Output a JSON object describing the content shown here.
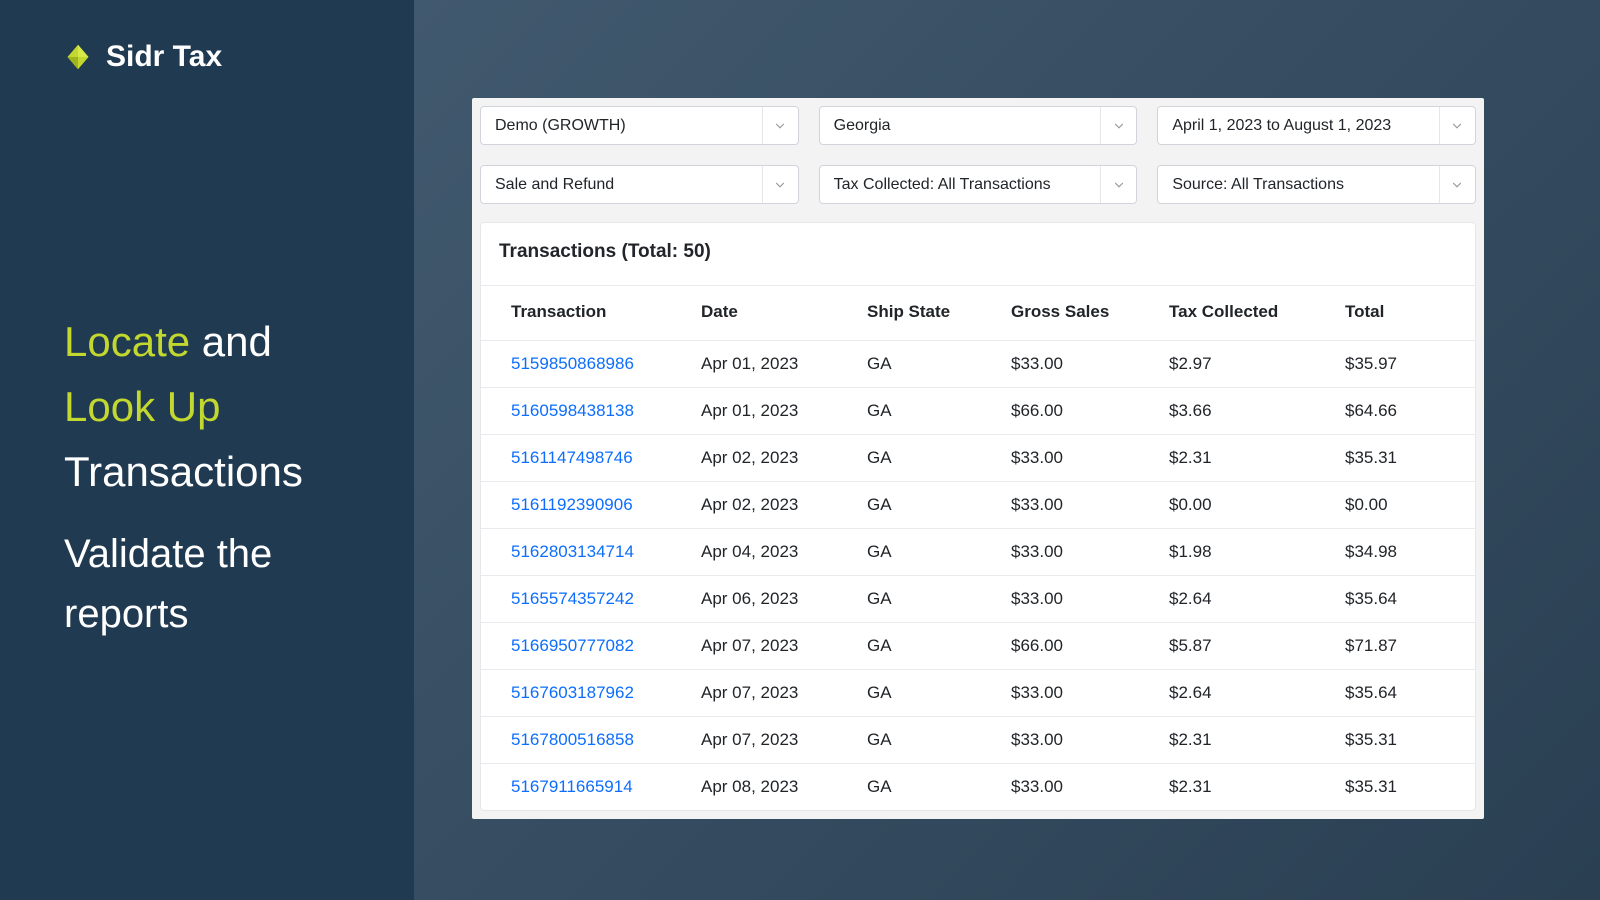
{
  "brand": {
    "name": "Sidr Tax"
  },
  "heading": {
    "accent1": "Locate",
    "word1": "and",
    "accent2": "Look Up",
    "word2": "Transactions"
  },
  "subheading": {
    "line1": "Validate the",
    "line2": "reports"
  },
  "filters": {
    "account": "Demo (GROWTH)",
    "state": "Georgia",
    "date_range": "April 1, 2023 to August 1, 2023",
    "type": "Sale and Refund",
    "tax_collected": "Tax Collected: All Transactions",
    "source": "Source: All Transactions"
  },
  "table": {
    "title": "Transactions (Total: 50)",
    "columns": [
      "Transaction",
      "Date",
      "Ship State",
      "Gross Sales",
      "Tax Collected",
      "Total"
    ],
    "rows": [
      {
        "transaction": "5159850868986",
        "date": "Apr 01, 2023",
        "ship_state": "GA",
        "gross_sales": "$33.00",
        "tax_collected": "$2.97",
        "total": "$35.97"
      },
      {
        "transaction": "5160598438138",
        "date": "Apr 01, 2023",
        "ship_state": "GA",
        "gross_sales": "$66.00",
        "tax_collected": "$3.66",
        "total": "$64.66"
      },
      {
        "transaction": "5161147498746",
        "date": "Apr 02, 2023",
        "ship_state": "GA",
        "gross_sales": "$33.00",
        "tax_collected": "$2.31",
        "total": "$35.31"
      },
      {
        "transaction": "5161192390906",
        "date": "Apr 02, 2023",
        "ship_state": "GA",
        "gross_sales": "$33.00",
        "tax_collected": "$0.00",
        "total": "$0.00"
      },
      {
        "transaction": "5162803134714",
        "date": "Apr 04, 2023",
        "ship_state": "GA",
        "gross_sales": "$33.00",
        "tax_collected": "$1.98",
        "total": "$34.98"
      },
      {
        "transaction": "5165574357242",
        "date": "Apr 06, 2023",
        "ship_state": "GA",
        "gross_sales": "$33.00",
        "tax_collected": "$2.64",
        "total": "$35.64"
      },
      {
        "transaction": "5166950777082",
        "date": "Apr 07, 2023",
        "ship_state": "GA",
        "gross_sales": "$66.00",
        "tax_collected": "$5.87",
        "total": "$71.87"
      },
      {
        "transaction": "5167603187962",
        "date": "Apr 07, 2023",
        "ship_state": "GA",
        "gross_sales": "$33.00",
        "tax_collected": "$2.64",
        "total": "$35.64"
      },
      {
        "transaction": "5167800516858",
        "date": "Apr 07, 2023",
        "ship_state": "GA",
        "gross_sales": "$33.00",
        "tax_collected": "$2.31",
        "total": "$35.31"
      },
      {
        "transaction": "5167911665914",
        "date": "Apr 08, 2023",
        "ship_state": "GA",
        "gross_sales": "$33.00",
        "tax_collected": "$2.31",
        "total": "$35.31"
      }
    ]
  },
  "colors": {
    "accent": "#c3d82e",
    "link": "#0d6efd",
    "sidebar_bg": "#203a52"
  }
}
